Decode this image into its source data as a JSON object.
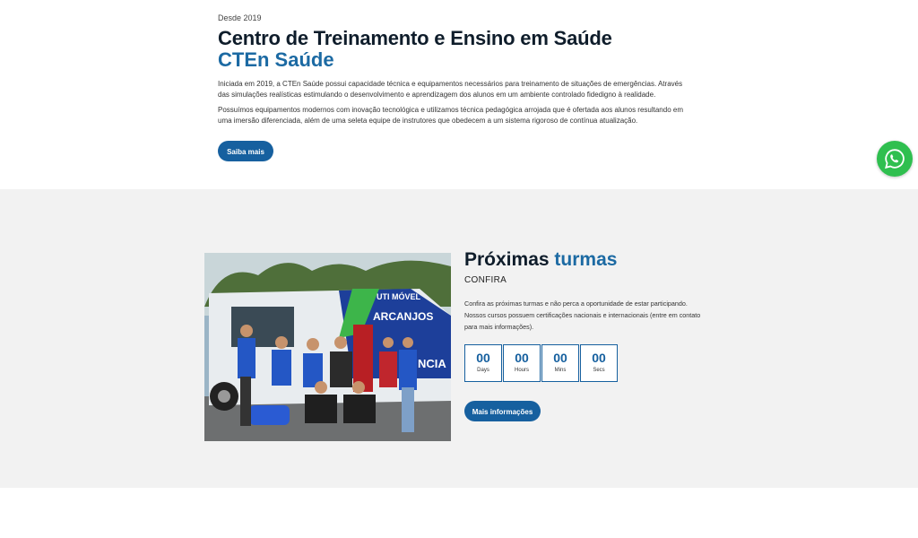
{
  "about": {
    "since": "Desde 2019",
    "title": "Centro de Treinamento e Ensino em Saúde",
    "subtitle": "CTEn Saúde",
    "paragraph1": "Iniciada em 2019, a CTEn Saúde possui capacidade técnica e equipamentos necessários para treinamento de situações de emergências. Através das simulações realísticas estimulando o desenvolvimento e aprendizagem dos alunos em um ambiente controlado fidedigno à realidade.",
    "paragraph2": "Possuímos equipamentos modernos com inovação tecnológica e utilizamos técnica pedagógica arrojada que é ofertada aos alunos resultando em uma imersão diferenciada, além de uma seleta equipe de instrutores que obedecem a um sistema rigoroso de contínua atualização.",
    "button_label": "Saiba mais"
  },
  "turmas": {
    "title_part1": "Próximas",
    "title_part2": "turmas",
    "kicker": "CONFIRA",
    "description": "Confira as próximas turmas e não perca a oportunidade de estar participando. Nossos cursos possuem certificações nacionais e internacionais (entre em contato para mais informações).",
    "countdown": [
      {
        "value": "00",
        "label": "Days"
      },
      {
        "value": "00",
        "label": "Hours"
      },
      {
        "value": "00",
        "label": "Mins"
      },
      {
        "value": "00",
        "label": "Secs"
      }
    ],
    "button_label": "Mais informações",
    "photo": {
      "sign_top": "UTI MÓVEL",
      "sign_mid": "ARCANJOS",
      "sign_side": "NCIA"
    }
  },
  "whatsapp": {
    "icon": "whatsapp-icon"
  },
  "colors": {
    "brand_blue": "#16609f",
    "accent_blue": "#1c6aa3",
    "whatsapp_green": "#2fbf4f",
    "section_gray": "#f2f2f2"
  }
}
